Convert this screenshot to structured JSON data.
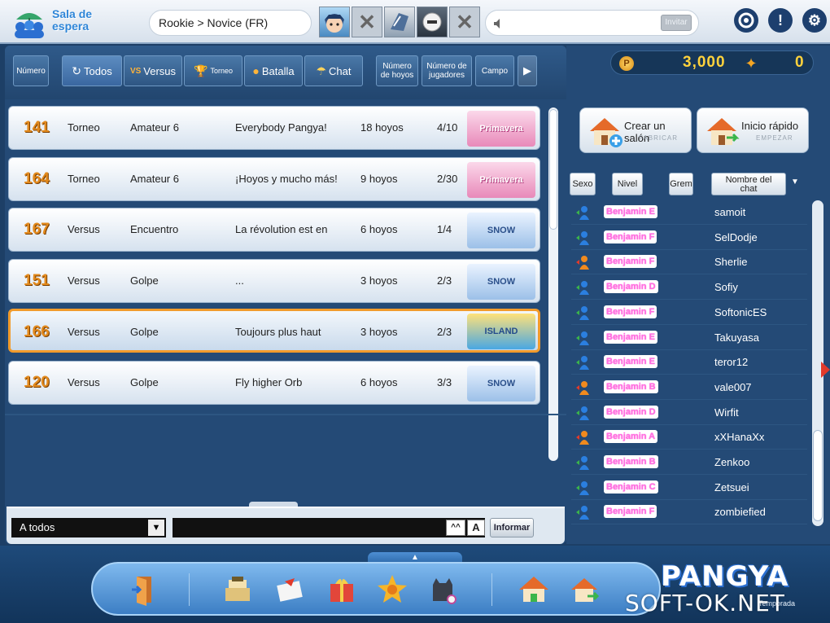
{
  "header": {
    "lobby_title_line1": "Sala de",
    "lobby_title_line2": "espera",
    "breadcrumb": "Rookie > Novice (FR)",
    "invite_label": "Invitar"
  },
  "filters": {
    "number_label": "Número",
    "all_label": "Todos",
    "versus_label": "Versus",
    "tournament_label": "Torneo",
    "battle_label": "Batalla",
    "chat_label": "Chat",
    "holes_label_1": "Número",
    "holes_label_2": "de hoyos",
    "players_label_1": "Número de",
    "players_label_2": "jugadores",
    "course_label": "Campo"
  },
  "rooms": [
    {
      "number": "141",
      "type": "Torneo",
      "mode": "Amateur 6",
      "name": "Everybody Pangya!",
      "holes": "18 hoyos",
      "players": "4/10",
      "badge": "Primavera"
    },
    {
      "number": "164",
      "type": "Torneo",
      "mode": "Amateur 6",
      "name": "¡Hoyos y mucho más!",
      "holes": "9 hoyos",
      "players": "2/30",
      "badge": "Primavera"
    },
    {
      "number": "167",
      "type": "Versus",
      "mode": "Encuentro",
      "name": "La révolution est en",
      "holes": "6 hoyos",
      "players": "1/4",
      "badge": "SNOW"
    },
    {
      "number": "151",
      "type": "Versus",
      "mode": "Golpe",
      "name": "...",
      "holes": "3 hoyos",
      "players": "2/3",
      "badge": "SNOW"
    },
    {
      "number": "166",
      "type": "Versus",
      "mode": "Golpe",
      "name": "Toujours plus haut",
      "holes": "3 hoyos",
      "players": "2/3",
      "badge": "ISLAND"
    },
    {
      "number": "120",
      "type": "Versus",
      "mode": "Golpe",
      "name": "Fly higher Orb",
      "holes": "6 hoyos",
      "players": "3/3",
      "badge": "SNOW"
    }
  ],
  "chat": {
    "recipient": "A todos",
    "input_value": "",
    "font_small": "^^",
    "font_large": "A",
    "send_label": "Informar"
  },
  "wallet": {
    "pang": "3,000",
    "cookies": "0"
  },
  "actions": {
    "create_label": "Crear un salón",
    "create_sub": "FABRICAR",
    "quick_label": "Inicio rápido",
    "quick_sub": "EMPEZAR"
  },
  "user_tabs": {
    "sex": "Sexo",
    "level": "Nivel",
    "guild": "Grem",
    "nick_1": "Nombre del",
    "nick_2": "chat"
  },
  "users": [
    {
      "level": "Benjamin E",
      "name": "samoit",
      "gender": "male"
    },
    {
      "level": "Benjamin F",
      "name": "SelDodje",
      "gender": "male"
    },
    {
      "level": "Benjamin F",
      "name": "Sherlie",
      "gender": "female"
    },
    {
      "level": "Benjamin D",
      "name": "Sofiy",
      "gender": "male"
    },
    {
      "level": "Benjamin F",
      "name": "SoftonicES",
      "gender": "male"
    },
    {
      "level": "Benjamin E",
      "name": "Takuyasa",
      "gender": "male"
    },
    {
      "level": "Benjamin E",
      "name": "teror12",
      "gender": "male"
    },
    {
      "level": "Benjamin B",
      "name": "vale007",
      "gender": "female"
    },
    {
      "level": "Benjamin D",
      "name": "Wirfit",
      "gender": "male"
    },
    {
      "level": "Benjamin A",
      "name": "xXHanaXx",
      "gender": "female"
    },
    {
      "level": "Benjamin B",
      "name": "Zenkoo",
      "gender": "male"
    },
    {
      "level": "Benjamin C",
      "name": "Zetsuei",
      "gender": "male"
    },
    {
      "level": "Benjamin F",
      "name": "zombiefied",
      "gender": "male"
    }
  ],
  "brand": {
    "logo": "PANGYA",
    "season": "Temporada"
  },
  "watermark": "SOFT-OK.NET",
  "colors": {
    "selected_border": "#f19b2c",
    "room_number": "#e38a1d",
    "level_pink": "#ff6fe0",
    "panel_bg": "#244a76"
  }
}
